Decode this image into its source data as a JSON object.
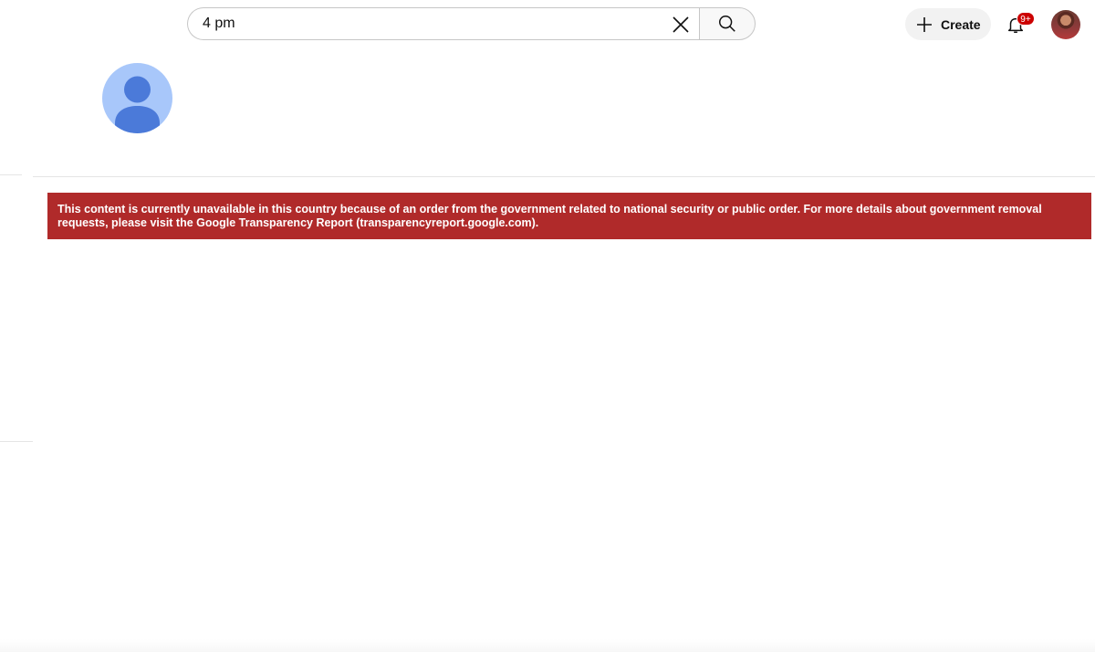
{
  "header": {
    "search": {
      "value": "4 pm",
      "clear_icon": "close-icon",
      "search_icon": "search-icon"
    },
    "create": {
      "label": "Create",
      "icon": "plus-icon"
    },
    "notifications": {
      "icon": "bell-icon",
      "badge": "9+",
      "badge_color": "#cc0000"
    },
    "user_avatar": {
      "icon": "avatar"
    }
  },
  "channel": {
    "avatar_icon": "default-person-avatar",
    "avatar_bg": "#a8c7fa",
    "avatar_fg": "#4b7ad9"
  },
  "alert": {
    "message": "This content is currently unavailable in this country because of an order from the government related to national security or public order. For more details about government removal requests, please visit the Google Transparency Report (transparencyreport.google.com).",
    "background": "#b02a2a",
    "text_color": "#ffffff"
  }
}
